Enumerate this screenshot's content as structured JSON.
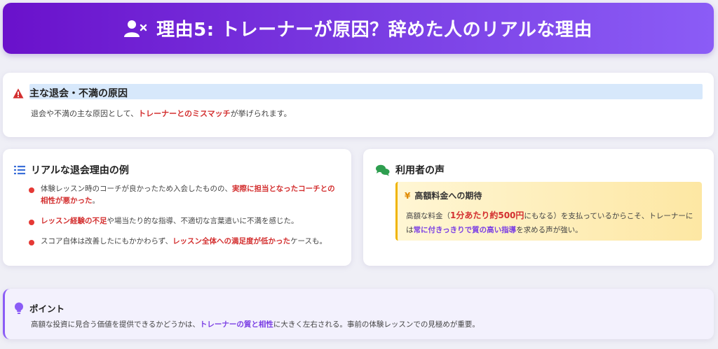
{
  "header": {
    "title": "理由5: トレーナーが原因？辞めた人のリアルな理由"
  },
  "main_causes": {
    "title": "主な退会・不満の原因",
    "text_before": "退会や不満の主な原因として、",
    "text_highlight": "トレーナーとのミスマッチ",
    "text_after": "が挙げられます。"
  },
  "examples": {
    "title": "リアルな退会理由の例",
    "items": [
      {
        "before": "体験レッスン時のコーチが良かったため入会したものの、",
        "highlight": "実際に担当となったコーチとの相性が悪かった",
        "after": "。"
      },
      {
        "before": "",
        "highlight": "レッスン経験の不足",
        "after": "や場当たり的な指導、不適切な言葉遣いに不満を感じた。"
      },
      {
        "before": "スコア自体は改善したにもかかわらず、",
        "highlight": "レッスン全体への満足度が低かった",
        "after": "ケースも。"
      }
    ]
  },
  "voices": {
    "title": "利用者の声",
    "box_icon": "¥",
    "box_title": "高額料金への期待",
    "body_1": "高額な料金（",
    "body_price": "1分あたり約500円",
    "body_2": "にもなる）を支払っているからこそ、トレーナーには",
    "body_highlight": "常に付きっきりで質の高い指導",
    "body_3": "を求める声が強い。"
  },
  "point": {
    "title": "ポイント",
    "text_before": "高額な投資に見合う価値を提供できるかどうかは、",
    "text_highlight": "トレーナーの質と相性",
    "text_after": "に大きく左右される。事前の体験レッスンでの見極めが重要。"
  },
  "colors": {
    "header_start": "#6a11cb",
    "header_end": "#8b5cf6",
    "accent_red": "#d32f2f",
    "accent_purple": "#7b3fe4"
  },
  "icons": [
    "user-times-icon",
    "warning-icon",
    "list-icon",
    "comments-icon",
    "yen-icon",
    "lightbulb-icon"
  ]
}
